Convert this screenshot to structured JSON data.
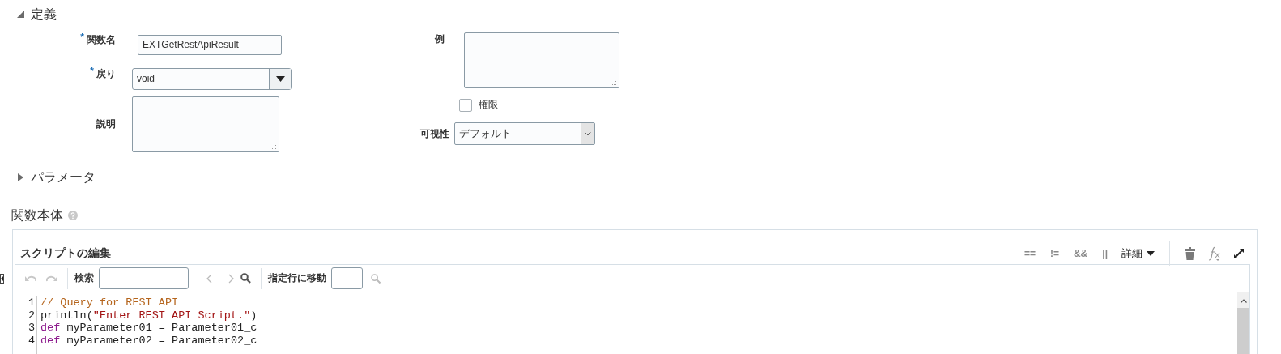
{
  "definition_section": {
    "title": "定義",
    "expanded": true
  },
  "left_fields": [
    {
      "kind": "text",
      "label": "関数名",
      "required_mark": "*",
      "value": "EXTGetRestApiResult"
    },
    {
      "kind": "combo",
      "label": "戻り",
      "required_mark": "*",
      "value": "void"
    },
    {
      "kind": "textarea",
      "label": "説明"
    }
  ],
  "right_fields": [
    {
      "kind": "textarea",
      "label": "例"
    },
    {
      "kind": "checkbox",
      "label": "権限",
      "checked": false
    },
    {
      "kind": "select",
      "label": "可視性",
      "value": "デフォルト"
    }
  ],
  "parameters_section": {
    "title": "パラメータ",
    "expanded": false
  },
  "function_body": {
    "title": "関数本体",
    "editor": {
      "title": "スクリプトの編集",
      "operators": [
        "==",
        "!=",
        "&&",
        "||"
      ],
      "more_menu": "詳細",
      "search_label": "検索",
      "goto_label": "指定行に移動",
      "lines": [
        {
          "number": "1",
          "tokens": [
            {
              "kind": "comment",
              "text": "// Query for REST API"
            }
          ]
        },
        {
          "number": "2",
          "tokens": [
            {
              "kind": "plain",
              "text": "println("
            },
            {
              "kind": "string",
              "text": "\"Enter REST API Script.\""
            },
            {
              "kind": "plain",
              "text": ")"
            }
          ]
        },
        {
          "number": "3",
          "tokens": [
            {
              "kind": "keyword",
              "text": "def"
            },
            {
              "kind": "plain",
              "text": " myParameter01 = Parameter01_c"
            }
          ]
        },
        {
          "number": "4",
          "tokens": [
            {
              "kind": "keyword",
              "text": "def"
            },
            {
              "kind": "plain",
              "text": " myParameter02 = Parameter02_c"
            }
          ]
        }
      ]
    }
  }
}
